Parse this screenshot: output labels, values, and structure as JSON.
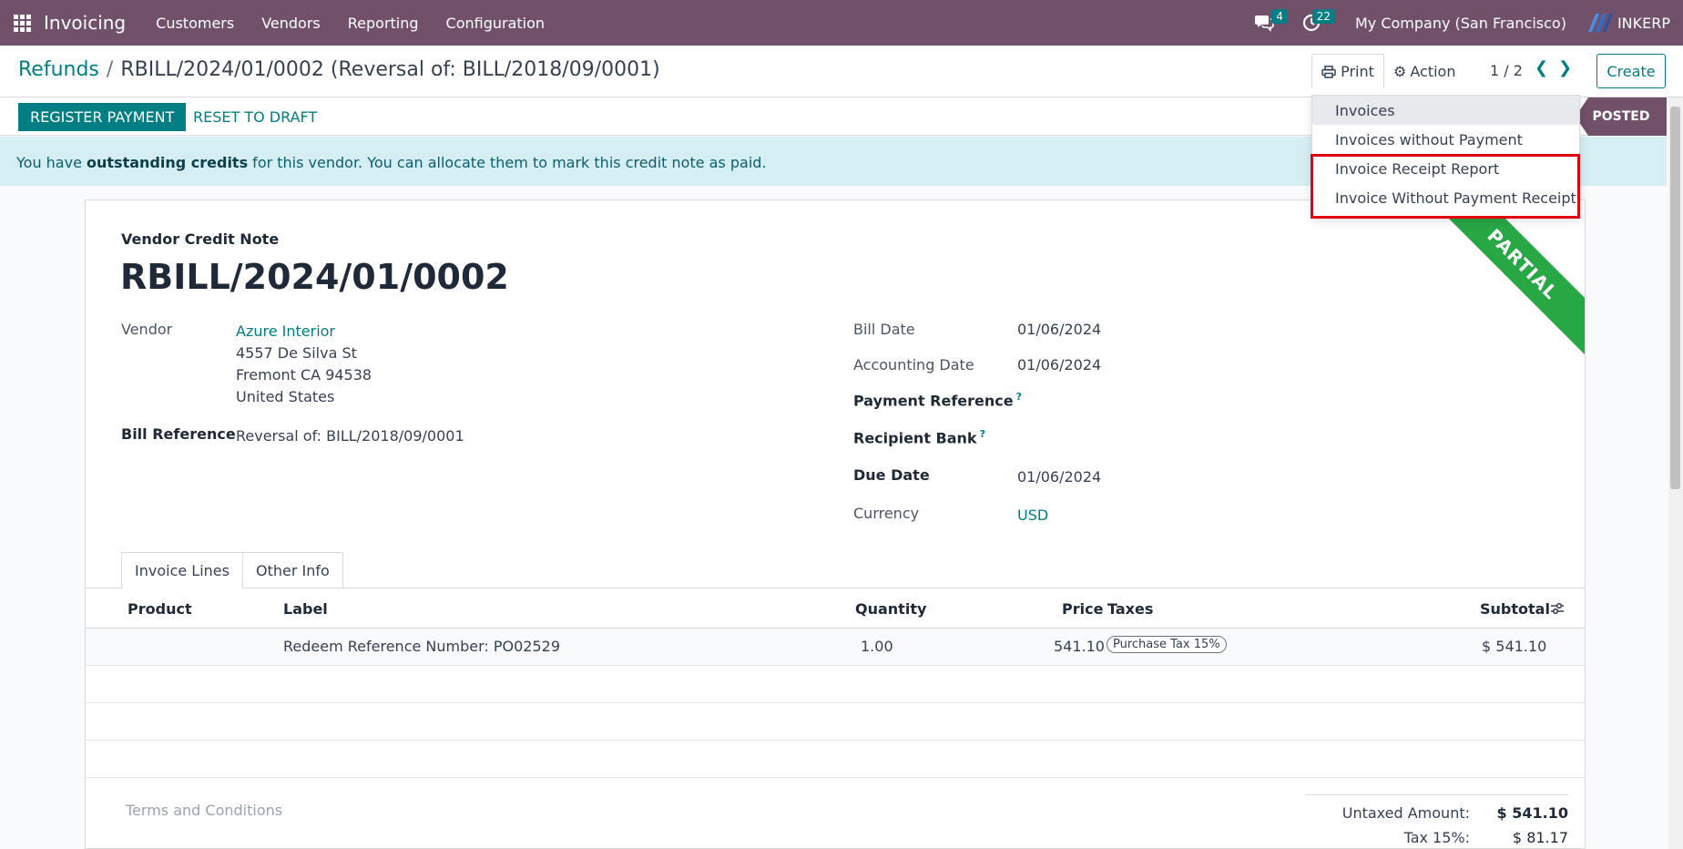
{
  "navbar": {
    "brand": "Invoicing",
    "menu": [
      "Customers",
      "Vendors",
      "Reporting",
      "Configuration"
    ],
    "messages_count": "4",
    "activities_count": "22",
    "company": "My Company (San Francisco)",
    "user": "INKERP"
  },
  "control": {
    "breadcrumb_parent": "Refunds",
    "breadcrumb_separator": "/",
    "breadcrumb_current": "RBILL/2024/01/0002 (Reversal of: BILL/2018/09/0001)",
    "print_label": "Print",
    "action_label": "Action",
    "pager": "1 / 2",
    "create_label": "Create"
  },
  "statusbar": {
    "register_payment": "REGISTER PAYMENT",
    "reset_to_draft": "RESET TO DRAFT",
    "status": "POSTED"
  },
  "alert": {
    "prefix": "You have ",
    "bold": "outstanding credits",
    "suffix": " for this vendor. You can allocate them to mark this credit note as paid."
  },
  "print_menu": {
    "items": [
      "Invoices",
      "Invoices without Payment",
      "Invoice Receipt Report",
      "Invoice Without Payment Receipt"
    ]
  },
  "document": {
    "ribbon": "PARTIAL",
    "type": "Vendor Credit Note",
    "number": "RBILL/2024/01/0002",
    "vendor_label": "Vendor",
    "vendor_name": "Azure Interior",
    "vendor_address": [
      "4557 De Silva St",
      "Fremont CA 94538",
      "United States"
    ],
    "bill_reference_label": "Bill Reference",
    "bill_reference": "Reversal of: BILL/2018/09/0001",
    "bill_date_label": "Bill Date",
    "bill_date": "01/06/2024",
    "accounting_date_label": "Accounting Date",
    "accounting_date": "01/06/2024",
    "payment_reference_label": "Payment Reference",
    "recipient_bank_label": "Recipient Bank",
    "help_mark": "?",
    "due_date_label": "Due Date",
    "due_date": "01/06/2024",
    "currency_label": "Currency",
    "currency": "USD"
  },
  "tabs": [
    "Invoice Lines",
    "Other Info"
  ],
  "lines": {
    "headers": [
      "Product",
      "Label",
      "Quantity",
      "Price",
      "Taxes",
      "Subtotal"
    ],
    "rows": [
      {
        "product": "",
        "label": "Redeem Reference Number: PO02529",
        "quantity": "1.00",
        "price": "541.10",
        "tax": "Purchase Tax 15%",
        "subtotal": "$ 541.10"
      }
    ]
  },
  "footer": {
    "terms_placeholder": "Terms and Conditions",
    "untaxed_label": "Untaxed Amount:",
    "untaxed_value": "$ 541.10",
    "tax_label": "Tax 15%:",
    "tax_value": "$ 81.17"
  },
  "colors": {
    "navbar": "#71506a",
    "primary": "#017e84",
    "ribbon": "#28a745",
    "highlight": "#e3000f"
  }
}
